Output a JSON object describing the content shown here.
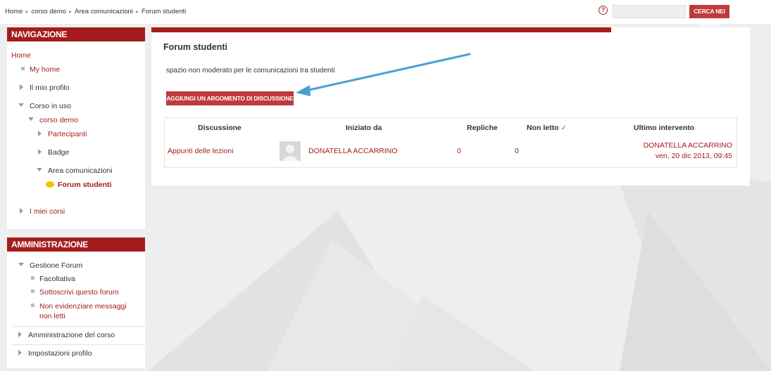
{
  "breadcrumb": {
    "items": [
      "Home",
      "corso demo",
      "Area comunicazioni",
      "Forum studenti"
    ],
    "separator": "▸"
  },
  "search": {
    "button_label": "CERCA NEI FORUM",
    "value": "",
    "placeholder": ""
  },
  "navigation": {
    "header": "NAVIGAZIONE",
    "home": "Home",
    "my_home": "My home",
    "my_profile": "Il mio profilo",
    "current_course": "Corso in uso",
    "course_demo": "corso demo",
    "participants": "Partecipanti",
    "badge": "Badge",
    "area_comunicazioni": "Area comunicazioni",
    "forum_studenti": "Forum studenti",
    "my_courses": "I miei corsi"
  },
  "administration": {
    "header": "AMMINISTRAZIONE",
    "forum_management": "Gestione Forum",
    "optional": "Facoltativa",
    "subscribe": "Sottoscrivi questo forum",
    "no_highlight": "Non evidenziare messaggi",
    "no_highlight_2": "non letti",
    "course_admin": "Amministrazione del corso",
    "profile_settings": "Impostazioni profilo"
  },
  "forum": {
    "title": "Forum studenti",
    "intro": "spazio non moderato per le comunicazioni tra studenti",
    "add_topic_label": "AGGIUNGI UN ARGOMENTO DI DISCUSSIONE"
  },
  "table": {
    "headers": {
      "discussion": "Discussione",
      "started_by": "Iniziato da",
      "replies": "Repliche",
      "unread": "Non letto",
      "last_post": "Ultimo intervento"
    },
    "rows": [
      {
        "discussion": "Appunti delle lezioni",
        "started_by": "DONATELLA ACCARRINO",
        "replies": "0",
        "unread": "0",
        "last_post_author": "DONATELLA ACCARRINO",
        "last_post_date": "ven, 20 dic 2013, 09:45"
      }
    ]
  },
  "colors": {
    "brand": "#a51c1c",
    "button": "#c0393b",
    "highlight_border": "#4aa0d5",
    "arrow": "#4aa0d5"
  },
  "icons": [
    "help-icon",
    "checkmark-icon",
    "forum-chat-icon",
    "user-avatar-icon"
  ]
}
